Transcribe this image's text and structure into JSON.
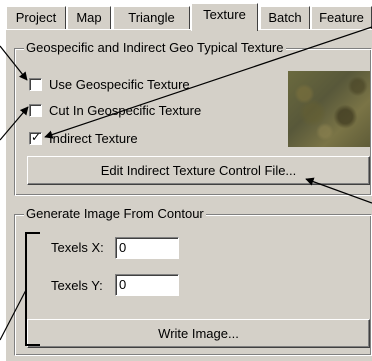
{
  "tabs": [
    {
      "label": "Project",
      "active": false
    },
    {
      "label": "Map",
      "active": false
    },
    {
      "label": "Triangle",
      "active": false
    },
    {
      "label": "Texture",
      "active": true
    },
    {
      "label": "Batch",
      "active": false
    },
    {
      "label": "Feature",
      "active": false
    }
  ],
  "geo_group": {
    "title": "Geospecific and Indirect Geo Typical Texture",
    "checkboxes": [
      {
        "label": "Use Geospecific Texture",
        "checked": false
      },
      {
        "label": "Cut In Geospecific Texture",
        "checked": false
      },
      {
        "label": "Indirect Texture",
        "checked": true
      }
    ],
    "check_mark": "✓",
    "edit_button": "Edit Indirect Texture Control File..."
  },
  "contour_group": {
    "title": "Generate Image From Contour",
    "texels_x_label": "Texels X:",
    "texels_x_value": "0",
    "texels_y_label": "Texels Y:",
    "texels_y_value": "0",
    "write_button": "Write Image..."
  },
  "colors": {
    "dialog_bg": "#d4d0c8",
    "page_bg": "#ffffff",
    "texture_base": "#6b6a3e"
  }
}
